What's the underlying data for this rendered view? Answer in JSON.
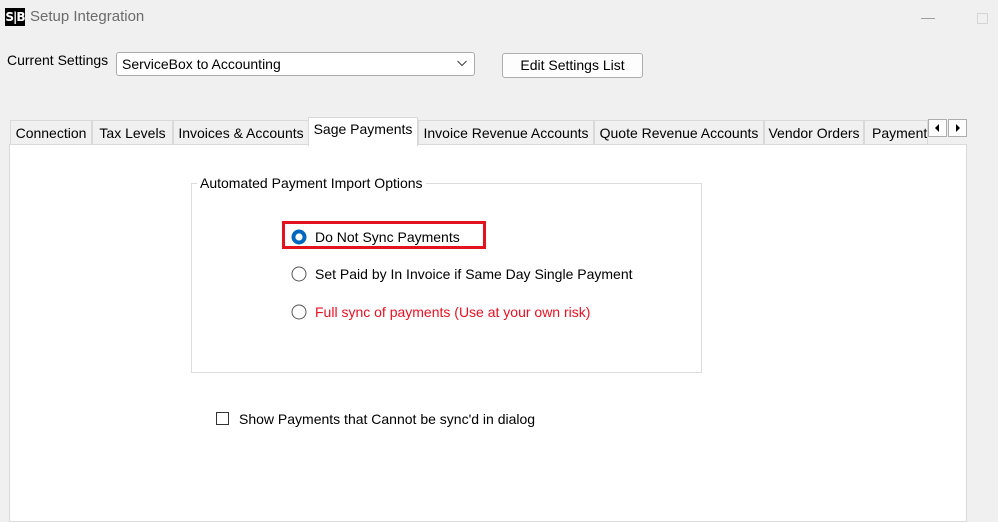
{
  "window": {
    "logo_text": "S|B",
    "title": "Setup Integration"
  },
  "settings": {
    "label": "Current Settings",
    "selected": "ServiceBox to Accounting",
    "edit_button": "Edit Settings List"
  },
  "tabs": [
    {
      "label": "Connection",
      "selected": false
    },
    {
      "label": "Tax Levels",
      "selected": false
    },
    {
      "label": "Invoices & Accounts",
      "selected": false
    },
    {
      "label": "Sage Payments",
      "selected": true
    },
    {
      "label": "Invoice Revenue Accounts",
      "selected": false
    },
    {
      "label": "Quote Revenue Accounts",
      "selected": false
    },
    {
      "label": "Vendor Orders",
      "selected": false
    },
    {
      "label": "Payment",
      "selected": false
    }
  ],
  "payments_page": {
    "group_title": "Automated Payment Import Options",
    "options": [
      {
        "label": "Do Not Sync Payments",
        "checked": true
      },
      {
        "label": "Set Paid by In Invoice if Same Day Single Payment",
        "checked": false
      },
      {
        "label": "Full sync of payments (Use at your own risk)",
        "checked": false,
        "color": "#e81123"
      }
    ],
    "show_unsynced_label": "Show Payments that Cannot be sync'd in dialog",
    "show_unsynced_checked": false
  },
  "colors": {
    "highlight": "#e3121f",
    "radio_selected": "#0067c0"
  },
  "icons": {
    "minimize": "minimize-icon",
    "maximize": "maximize-icon",
    "dropdown": "chevron-down-icon",
    "tab_scroll_left": "arrow-left-icon",
    "tab_scroll_right": "arrow-right-icon"
  }
}
